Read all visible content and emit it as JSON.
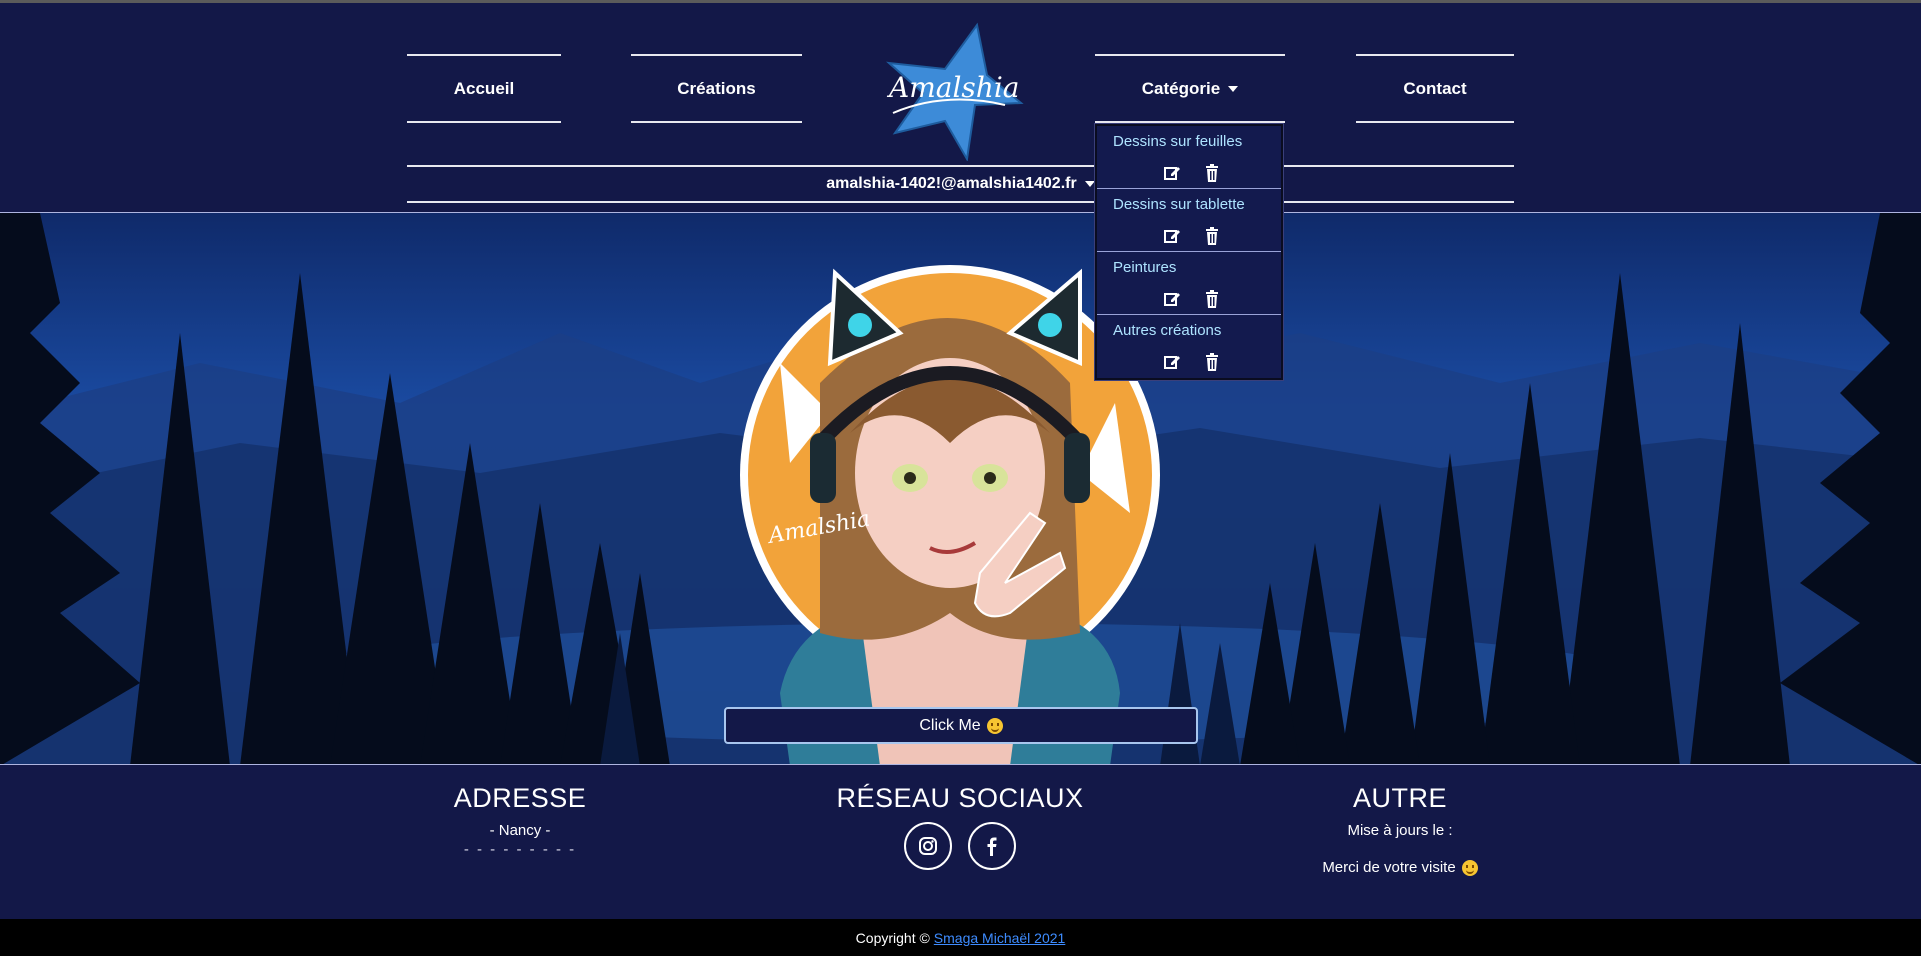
{
  "nav": {
    "home": "Accueil",
    "creations": "Créations",
    "category": "Catégorie",
    "contact": "Contact",
    "logo_text": "Amalshia",
    "account": "amalshia-1402!@amalshia1402.fr"
  },
  "category_menu": {
    "items": [
      {
        "label": "Dessins sur feuilles"
      },
      {
        "label": "Dessins sur tablette"
      },
      {
        "label": "Peintures"
      },
      {
        "label": "Autres créations"
      }
    ]
  },
  "hero": {
    "button_label": "Click Me",
    "signature": "Amalshia"
  },
  "footer": {
    "address": {
      "title": "ADRESSE",
      "city": "- Nancy -",
      "dashes": "- - - - - - - - -"
    },
    "social": {
      "title": "RÉSEAU SOCIAUX",
      "icons": [
        "instagram-icon",
        "facebook-icon"
      ]
    },
    "other": {
      "title": "AUTRE",
      "update": "Mise à jours le :",
      "thanks": "Merci de votre visite"
    }
  },
  "copyright": {
    "prefix": "Copyright ©",
    "author": "Smaga Michaël 2021"
  },
  "colors": {
    "background": "#131848",
    "dropdown_text": "#aee3ff",
    "link": "#3e8cff",
    "accent_orange": "#f2a33a",
    "button_border": "#a8c6ee"
  }
}
